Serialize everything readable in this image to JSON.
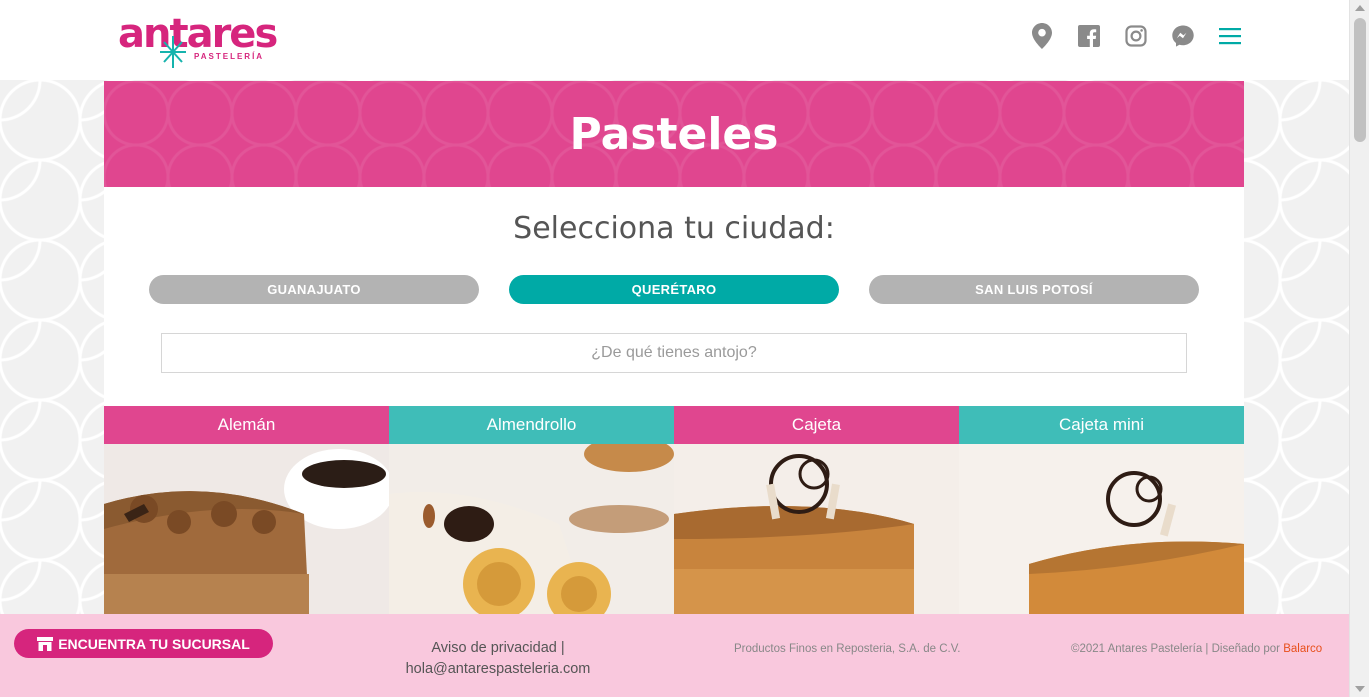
{
  "header": {
    "logo_text": "antares",
    "logo_sub": "PASTELERÍA",
    "icons": [
      "location-icon",
      "facebook-icon",
      "instagram-icon",
      "messenger-icon",
      "menu-icon"
    ]
  },
  "hero": {
    "title": "Pasteles"
  },
  "selector": {
    "prompt": "Selecciona tu ciudad:",
    "cities": [
      "GUANAJUATO",
      "QUERÉTARO",
      "SAN LUIS POTOSÍ"
    ],
    "active_city": "QUERÉTARO"
  },
  "search": {
    "placeholder": "¿De qué tienes antojo?"
  },
  "products": [
    {
      "name": "Alemán",
      "header_color": "#e0468f"
    },
    {
      "name": "Almendrollo",
      "header_color": "#3fbdb8"
    },
    {
      "name": "Cajeta",
      "header_color": "#e0468f"
    },
    {
      "name": "Cajeta mini",
      "header_color": "#3fbdb8"
    }
  ],
  "footer": {
    "find_button": "ENCUENTRA TU SUCURSAL",
    "privacy": "Aviso de privacidad |",
    "email": "hola@antarespasteleria.com",
    "company": "Productos Finos en Reposteria, S.A. de C.V.",
    "copyright": "©2021 Antares Pastelería | Diseñado por ",
    "designer": "Balarco"
  },
  "colors": {
    "brand_pink": "#d6257d",
    "hero_pink": "#e0468f",
    "teal": "#00aaa6",
    "teal_light": "#3fbdb8",
    "footer_bg": "#f9c8dd",
    "inactive_button": "#b3b3b3"
  }
}
